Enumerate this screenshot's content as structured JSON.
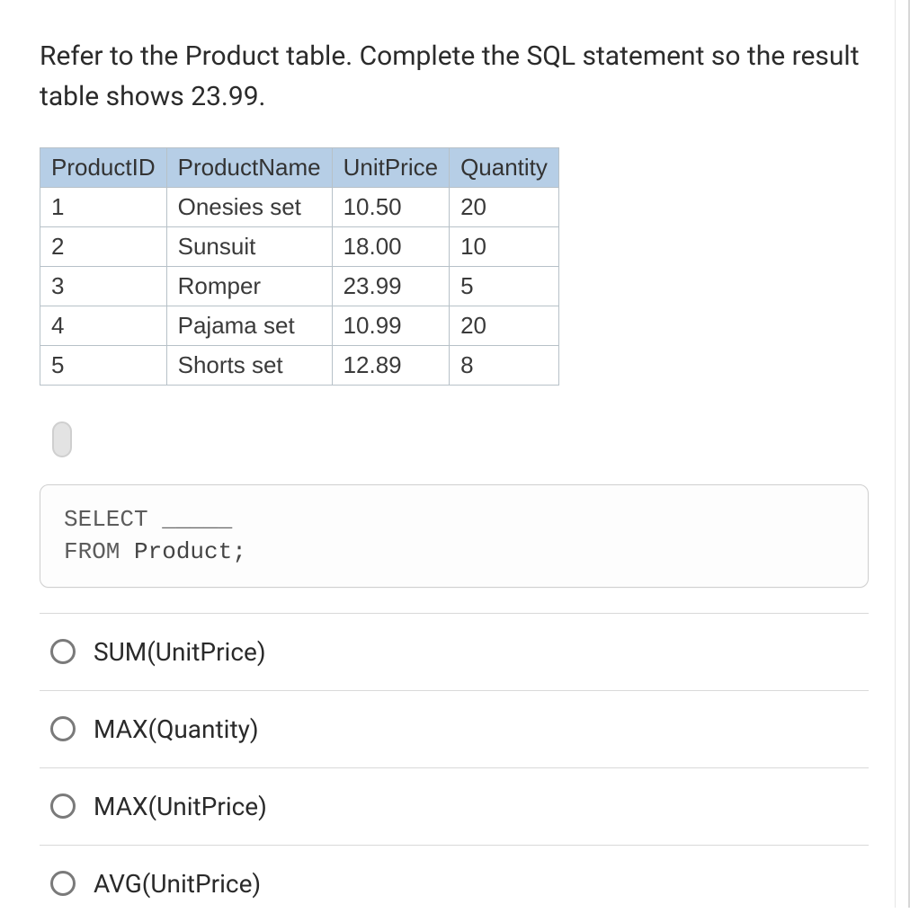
{
  "question": "Refer to the Product table. Complete the SQL statement so the result table shows 23.99.",
  "table": {
    "headers": [
      "ProductID",
      "ProductName",
      "UnitPrice",
      "Quantity"
    ],
    "rows": [
      [
        "1",
        "Onesies set",
        "10.50",
        "20"
      ],
      [
        "2",
        "Sunsuit",
        "18.00",
        "10"
      ],
      [
        "3",
        "Romper",
        "23.99",
        "5"
      ],
      [
        "4",
        "Pajama set",
        "10.99",
        "20"
      ],
      [
        "5",
        "Shorts set",
        "12.89",
        "8"
      ]
    ]
  },
  "code": {
    "line1_kw": "SELECT",
    "line1_blank": " _____",
    "line2_kw": "FROM",
    "line2_rest": " Product;"
  },
  "options": [
    {
      "label": "SUM(UnitPrice)"
    },
    {
      "label": "MAX(Quantity)"
    },
    {
      "label": "MAX(UnitPrice)"
    },
    {
      "label": "AVG(UnitPrice)"
    }
  ]
}
